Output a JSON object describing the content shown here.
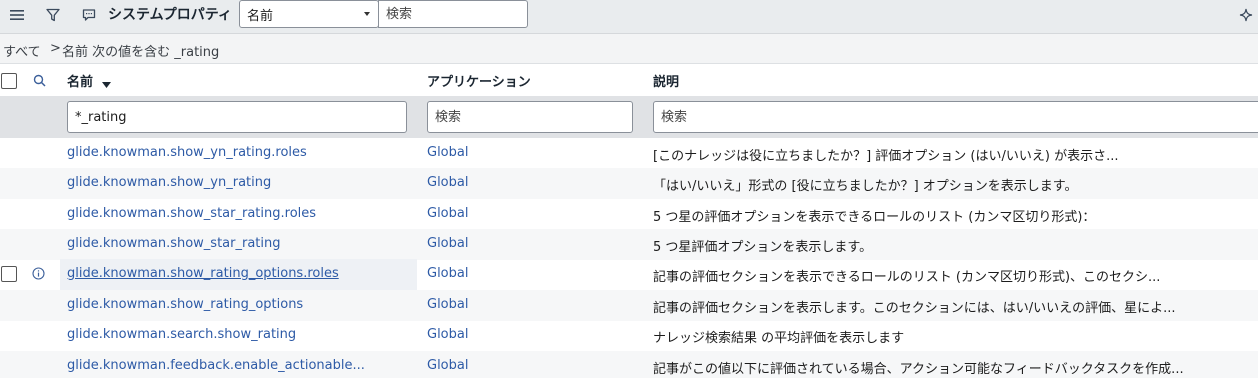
{
  "header": {
    "title": "システムプロパティ",
    "search_field": "名前",
    "search_placeholder": "検索"
  },
  "breadcrumb": {
    "all": "すべて",
    "sep": ">",
    "condition": "名前 次の値を含む _rating"
  },
  "columns": {
    "name": "名前",
    "application": "アプリケーション",
    "description": "説明"
  },
  "filters": {
    "name_value": "*_rating",
    "application_placeholder": "検索",
    "description_placeholder": "検索"
  },
  "rows": [
    {
      "name": "glide.knowman.show_yn_rating.roles",
      "application": "Global",
      "description": "[このナレッジは役に立ちましたか？] 評価オプション (はい/いいえ) が表示さ..."
    },
    {
      "name": "glide.knowman.show_yn_rating",
      "application": "Global",
      "description": "「はい/いいえ」形式の [役に立ちましたか？] オプションを表示します。"
    },
    {
      "name": "glide.knowman.show_star_rating.roles",
      "application": "Global",
      "description": "5 つ星の評価オプションを表示できるロールのリスト (カンマ区切り形式)："
    },
    {
      "name": "glide.knowman.show_star_rating",
      "application": "Global",
      "description": "5 つ星評価オプションを表示します。"
    },
    {
      "name": "glide.knowman.show_rating_options.roles",
      "application": "Global",
      "description": "記事の評価セクションを表示できるロールのリスト (カンマ区切り形式)、このセクシ..."
    },
    {
      "name": "glide.knowman.show_rating_options",
      "application": "Global",
      "description": "記事の評価セクションを表示します。このセクションには、はい/いいえの評価、星によ..."
    },
    {
      "name": "glide.knowman.search.show_rating",
      "application": "Global",
      "description": "ナレッジ検索結果 の平均評価を表示します"
    },
    {
      "name": "glide.knowman.feedback.enable_actionable...",
      "application": "Global",
      "description": "記事がこの値以下に評価されている場合、アクション可能なフィードバックタスクを作成..."
    }
  ]
}
